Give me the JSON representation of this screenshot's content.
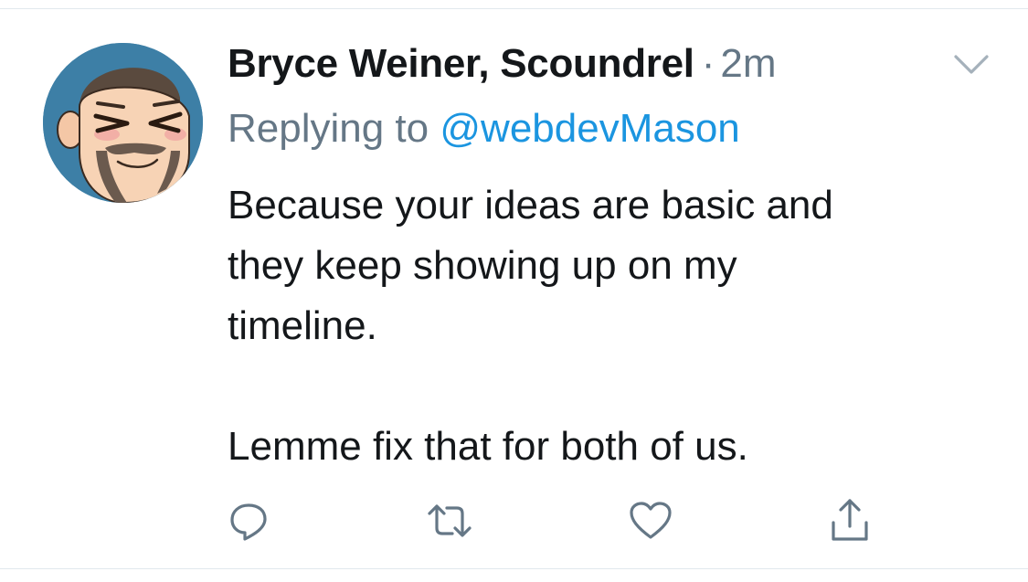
{
  "tweet": {
    "author_name": "Bryce Weiner, Scoundrel",
    "separator": "·",
    "timestamp": "2m",
    "reply_prefix": "Replying to",
    "reply_handle": "@webdevMason",
    "text_lines": [
      "Because your ideas are basic and",
      "they keep showing up on my",
      "timeline.",
      "",
      "Lemme fix that for both of us."
    ]
  },
  "icons": {
    "caret": "chevron-down-icon",
    "reply": "reply-icon",
    "retweet": "retweet-icon",
    "like": "heart-icon",
    "share": "share-icon"
  },
  "colors": {
    "text": "#14171a",
    "muted": "#657786",
    "link": "#1b95e0",
    "divider": "#e1e8ed",
    "avatar_background": "#3d7fa6"
  }
}
